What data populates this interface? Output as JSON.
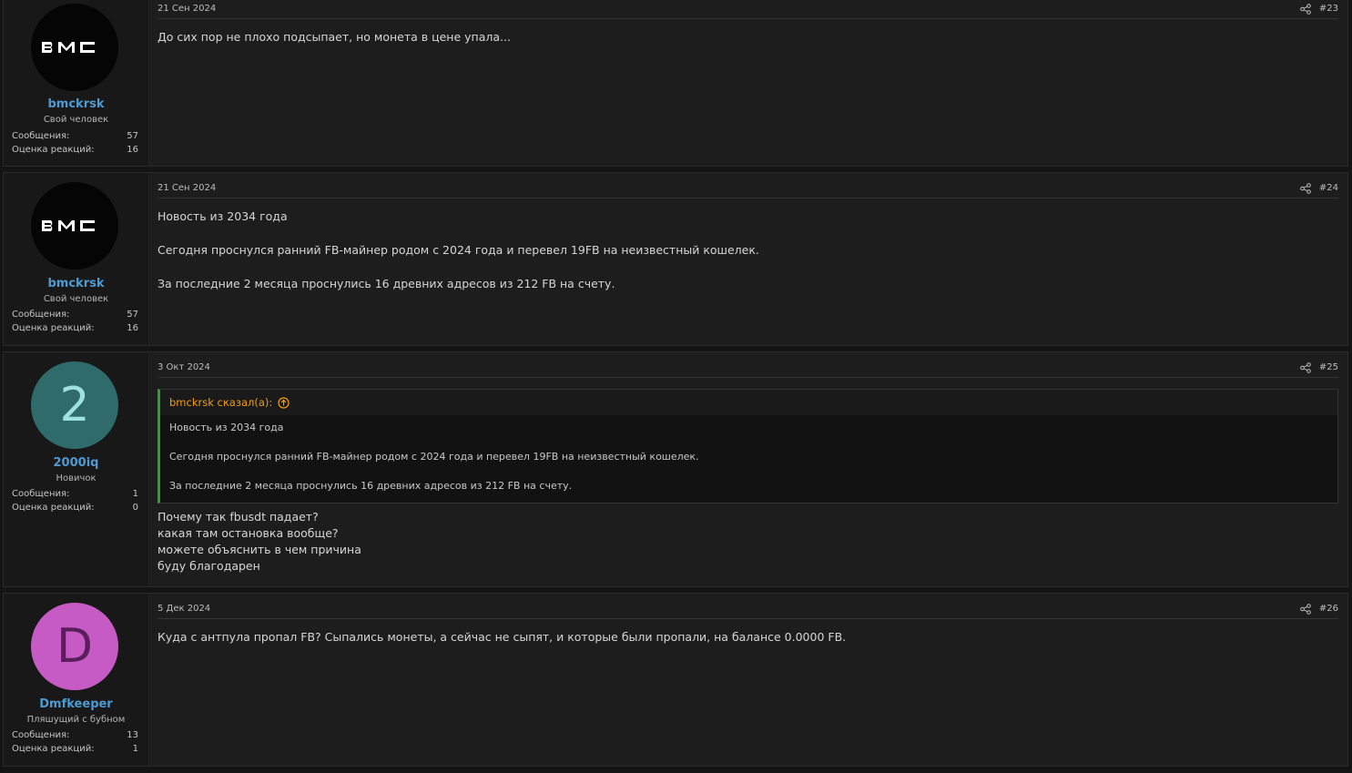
{
  "posts": [
    {
      "date": "21 Сен 2024",
      "number": "#23",
      "author": {
        "name": "bmckrsk",
        "title": "Свой человек",
        "avatar": {
          "type": "logo",
          "text": "BMC",
          "bg": "#050505"
        },
        "messages_label": "Сообщения:",
        "messages": "57",
        "reactions_label": "Оценка реакций:",
        "reactions": "16"
      },
      "body": [
        "До сих пор не плохо подсыпает, но монета в цене упала..."
      ]
    },
    {
      "date": "21 Сен 2024",
      "number": "#24",
      "author": {
        "name": "bmckrsk",
        "title": "Свой человек",
        "avatar": {
          "type": "logo",
          "text": "BMC",
          "bg": "#050505"
        },
        "messages_label": "Сообщения:",
        "messages": "57",
        "reactions_label": "Оценка реакций:",
        "reactions": "16"
      },
      "body": [
        "Новость из 2034 года",
        "Сегодня проснулся ранний FB-майнер родом с 2024 года и перевел 19FB на неизвестный кошелек.",
        "За последние 2 месяца проснулись 16 древних адресов из 212 FB на счету."
      ]
    },
    {
      "date": "3 Окт 2024",
      "number": "#25",
      "author": {
        "name": "2000iq",
        "title": "Новичок",
        "avatar": {
          "type": "letter",
          "text": "2",
          "bg": "#2f6b6b",
          "fg": "#9fe0e0"
        },
        "messages_label": "Сообщения:",
        "messages": "1",
        "reactions_label": "Оценка реакций:",
        "reactions": "0"
      },
      "quote": {
        "author_line": "bmckrsk сказал(а):",
        "lines": [
          "Новость из 2034 года",
          "Сегодня проснулся ранний FB-майнер родом с 2024 года и перевел 19FB на неизвестный кошелек.",
          "За последние 2 месяца проснулись 16 древних адресов из 212 FB на счету."
        ]
      },
      "body": [
        "Почему так fbusdt падает?",
        "какая там остановка вообще?",
        "можете объяснить в чем причина",
        "буду благодарен"
      ]
    },
    {
      "date": "5 Дек 2024",
      "number": "#26",
      "author": {
        "name": "Dmfkeeper",
        "title": "Пляшущий с бубном",
        "avatar": {
          "type": "letter",
          "text": "D",
          "bg": "#c65bc6",
          "fg": "#5a1f5a"
        },
        "messages_label": "Сообщения:",
        "messages": "13",
        "reactions_label": "Оценка реакций:",
        "reactions": "1"
      },
      "body": [
        "Куда с антпула пропал FB? Сыпались монеты, а сейчас не сыпят, и которые были пропали, на балансе 0.0000 FB."
      ]
    }
  ],
  "colors": {
    "username": "#4f9ad2",
    "quote_author": "#f39c12",
    "quote_border": "#2fa02f",
    "background": "#141414",
    "post_bg": "#1d1d1d"
  },
  "icons": {
    "share": "share-icon",
    "jump": "arrow-up-circle-icon"
  }
}
